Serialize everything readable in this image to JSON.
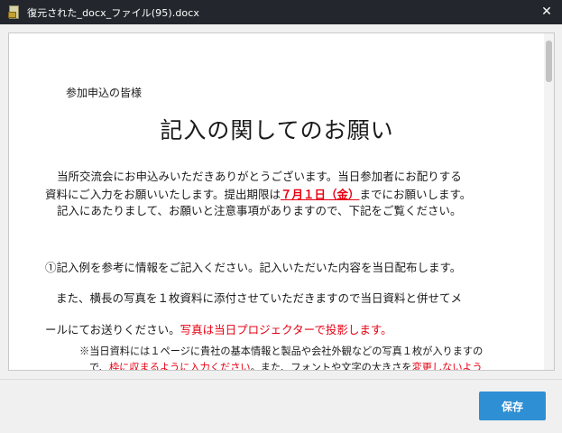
{
  "window": {
    "title": "復元された_docx_ファイル(95).docx",
    "icon": "docx-file-icon",
    "close_glyph": "✕"
  },
  "document": {
    "greeting": "参加申込の皆様",
    "heading": "記入の関してのお願い",
    "paragraphs": {
      "p1": "当所交流会にお申込みいただきありがとうございます。当日参加者にお配りする",
      "p2_before": "資料にご入力をお願いいたします。提出期限は",
      "p2_deadline": "７月１日（金）",
      "p2_after": "までにお願いします。",
      "p3": "記入にあたりまして、お願いと注意事項がありますので、下記をご覧ください。",
      "p4": "①記入例を参考に情報をご記入ください。記入いただいた内容を当日配布します。",
      "p5": "また、横長の写真を１枚資料に添付させていただきますので当日資料と併せてメ",
      "p6_before": "ールにてお送りください。",
      "p6_red": "写真は当日プロジェクターで投影します。",
      "p7": "※当日資料には１ページに貴社の基本情報と製品や会社外観などの写真１枚が入りますの",
      "p8_before": "で、",
      "p8_red1": "枠に収まるように入力ください",
      "p8_middle": "。また、フォントや文字の大きさを",
      "p8_red2": "変更しないよう"
    },
    "colors": {
      "emphasis": "#e60012"
    }
  },
  "footer": {
    "save_label": "保存",
    "save_color": "#2e8fd4"
  }
}
